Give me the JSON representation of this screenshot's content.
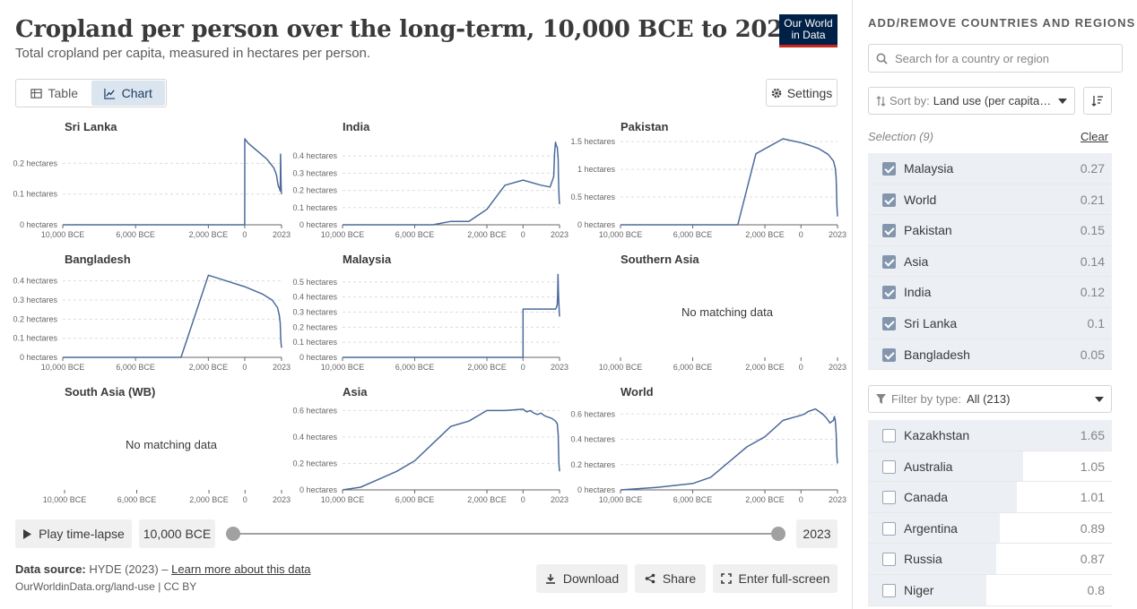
{
  "header": {
    "title": "Cropland per person over the long-term, 10,000 BCE to 2023",
    "subtitle": "Total cropland per capita, measured in hectares per person.",
    "logo_line1": "Our World",
    "logo_line2": "in Data"
  },
  "tabs": [
    {
      "label": "Table",
      "icon": "table-icon",
      "active": false
    },
    {
      "label": "Chart",
      "icon": "line-chart-icon",
      "active": true
    }
  ],
  "settings_label": "Settings",
  "timeline": {
    "play_label": "Play time-lapse",
    "start_label": "10,000 BCE",
    "end_label": "2023"
  },
  "footer": {
    "source_prefix": "Data source:",
    "source_text": "HYDE (2023) –",
    "learn_more": "Learn more about this data",
    "license": "OurWorldinData.org/land-use | CC BY",
    "download_label": "Download",
    "share_label": "Share",
    "fullscreen_label": "Enter full-screen"
  },
  "sidebar": {
    "heading": "ADD/REMOVE COUNTRIES AND REGIONS",
    "search_placeholder": "Search for a country or region",
    "sort_prefix": "Sort by:",
    "sort_value": "Land use (per capita):...",
    "selection_label": "Selection (9)",
    "clear_label": "Clear",
    "filter_prefix": "Filter by type:",
    "filter_value": "All (213)",
    "selected": [
      {
        "name": "Malaysia",
        "value": "0.27"
      },
      {
        "name": "World",
        "value": "0.21"
      },
      {
        "name": "Pakistan",
        "value": "0.15"
      },
      {
        "name": "Asia",
        "value": "0.14"
      },
      {
        "name": "India",
        "value": "0.12"
      },
      {
        "name": "Sri Lanka",
        "value": "0.1"
      },
      {
        "name": "Bangladesh",
        "value": "0.05"
      }
    ],
    "others": [
      {
        "name": "Kazakhstan",
        "value": "1.65",
        "share": 1.0
      },
      {
        "name": "Australia",
        "value": "1.05",
        "share": 0.636
      },
      {
        "name": "Canada",
        "value": "1.01",
        "share": 0.612
      },
      {
        "name": "Argentina",
        "value": "0.89",
        "share": 0.539
      },
      {
        "name": "Russia",
        "value": "0.87",
        "share": 0.527
      },
      {
        "name": "Niger",
        "value": "0.8",
        "share": 0.485
      }
    ]
  },
  "colors": {
    "line": "#4c6a9c",
    "grid": "#dddddd",
    "axis": "#666666",
    "bar": "#eceff4"
  },
  "chart_data": [
    {
      "type": "line",
      "title": "Sri Lanka",
      "yticks": [
        0,
        0.1,
        0.2
      ],
      "ylim": [
        0,
        0.28
      ],
      "unit": "hectares",
      "xticks": [
        "10,000 BCE",
        "6,000 BCE",
        "2,000 BCE",
        "0",
        "2023"
      ],
      "x": [
        -10000,
        0,
        1,
        200,
        600,
        800,
        1000,
        1200,
        1400,
        1600,
        1700,
        1750,
        1800,
        1850,
        1900,
        1950,
        1960,
        1970,
        1980,
        1990,
        2000,
        2010,
        2023
      ],
      "values": [
        0,
        0,
        0.28,
        0.265,
        0.245,
        0.235,
        0.225,
        0.215,
        0.2,
        0.185,
        0.17,
        0.16,
        0.14,
        0.125,
        0.12,
        0.11,
        0.15,
        0.23,
        0.2,
        0.16,
        0.13,
        0.11,
        0.1
      ]
    },
    {
      "type": "line",
      "title": "India",
      "yticks": [
        0,
        0.1,
        0.2,
        0.3,
        0.4
      ],
      "ylim": [
        0,
        0.5
      ],
      "unit": "hectares",
      "xticks": [
        "10,000 BCE",
        "6,000 BCE",
        "2,000 BCE",
        "0",
        "2023"
      ],
      "x": [
        -10000,
        -6000,
        -5000,
        -4000,
        -3000,
        -2000,
        -1000,
        0,
        1000,
        1500,
        1700,
        1750,
        1800,
        1850,
        1900,
        1950,
        1960,
        1970,
        1980,
        1990,
        2000,
        2010,
        2023
      ],
      "values": [
        0,
        0,
        0,
        0.02,
        0.02,
        0.09,
        0.23,
        0.26,
        0.23,
        0.22,
        0.28,
        0.42,
        0.48,
        0.46,
        0.45,
        0.38,
        0.3,
        0.26,
        0.22,
        0.19,
        0.16,
        0.14,
        0.12
      ]
    },
    {
      "type": "line",
      "title": "Pakistan",
      "yticks": [
        0,
        0.5,
        1,
        1.5
      ],
      "ylim": [
        0,
        1.55
      ],
      "unit": "hectares",
      "xticks": [
        "10,000 BCE",
        "6,000 BCE",
        "2,000 BCE",
        "0",
        "2023"
      ],
      "x": [
        -10000,
        -3500,
        -2500,
        -1000,
        0,
        500,
        1000,
        1500,
        1800,
        1900,
        1950,
        1970,
        1990,
        2023
      ],
      "values": [
        0,
        0,
        1.28,
        1.55,
        1.48,
        1.43,
        1.37,
        1.27,
        1.15,
        1.02,
        0.85,
        0.6,
        0.35,
        0.15
      ]
    },
    {
      "type": "line",
      "title": "Bangladesh",
      "yticks": [
        0,
        0.1,
        0.2,
        0.3,
        0.4
      ],
      "ylim": [
        0,
        0.45
      ],
      "unit": "hectares",
      "xticks": [
        "10,000 BCE",
        "6,000 BCE",
        "2,000 BCE",
        "0",
        "2023"
      ],
      "x": [
        -10000,
        -3500,
        -2000,
        -1000,
        0,
        1000,
        1500,
        1800,
        1900,
        1950,
        1970,
        1990,
        2023
      ],
      "values": [
        0,
        0,
        0.43,
        0.4,
        0.37,
        0.33,
        0.3,
        0.26,
        0.22,
        0.18,
        0.12,
        0.08,
        0.05
      ]
    },
    {
      "type": "line",
      "title": "Malaysia",
      "yticks": [
        0,
        0.1,
        0.2,
        0.3,
        0.4,
        0.5
      ],
      "ylim": [
        0,
        0.57
      ],
      "unit": "hectares",
      "xticks": [
        "10,000 BCE",
        "6,000 BCE",
        "2,000 BCE",
        "0",
        "2023"
      ],
      "x": [
        -10000,
        0,
        1,
        1500,
        1800,
        1850,
        1900,
        1920,
        1940,
        1960,
        1980,
        2000,
        2010,
        2023
      ],
      "values": [
        0,
        0,
        0.32,
        0.32,
        0.32,
        0.33,
        0.35,
        0.42,
        0.55,
        0.45,
        0.38,
        0.33,
        0.3,
        0.27
      ]
    },
    {
      "type": "line",
      "title": "Southern Asia",
      "message": "No matching data",
      "xticks": [
        "10,000 BCE",
        "6,000 BCE",
        "2,000 BCE",
        "0",
        "2023"
      ]
    },
    {
      "type": "line",
      "title": "South Asia (WB)",
      "message": "No matching data",
      "xticks": [
        "10,000 BCE",
        "6,000 BCE",
        "2,000 BCE",
        "0",
        "2023"
      ]
    },
    {
      "type": "line",
      "title": "Asia",
      "yticks": [
        0,
        0.2,
        0.4,
        0.6
      ],
      "ylim": [
        0,
        0.65
      ],
      "unit": "hectares",
      "xticks": [
        "10,000 BCE",
        "6,000 BCE",
        "2,000 BCE",
        "0",
        "2023"
      ],
      "x": [
        -10000,
        -9000,
        -8000,
        -7000,
        -6000,
        -5000,
        -4000,
        -3000,
        -2000,
        -1000,
        0,
        200,
        400,
        600,
        800,
        1000,
        1200,
        1400,
        1600,
        1800,
        1900,
        1950,
        1970,
        1990,
        2023
      ],
      "values": [
        0,
        0.02,
        0.08,
        0.14,
        0.22,
        0.35,
        0.48,
        0.52,
        0.6,
        0.6,
        0.61,
        0.59,
        0.6,
        0.58,
        0.57,
        0.58,
        0.56,
        0.55,
        0.54,
        0.52,
        0.5,
        0.42,
        0.3,
        0.2,
        0.14
      ]
    },
    {
      "type": "line",
      "title": "World",
      "yticks": [
        0,
        0.2,
        0.4,
        0.6
      ],
      "ylim": [
        0,
        0.68
      ],
      "unit": "hectares",
      "xticks": [
        "10,000 BCE",
        "6,000 BCE",
        "2,000 BCE",
        "0",
        "2023"
      ],
      "x": [
        -10000,
        -8000,
        -6000,
        -5000,
        -4000,
        -3000,
        -2000,
        -1000,
        0,
        200,
        400,
        600,
        800,
        1000,
        1200,
        1400,
        1600,
        1800,
        1850,
        1900,
        1950,
        1970,
        1990,
        2023
      ],
      "values": [
        0,
        0.02,
        0.05,
        0.1,
        0.22,
        0.34,
        0.42,
        0.55,
        0.59,
        0.6,
        0.62,
        0.63,
        0.64,
        0.62,
        0.6,
        0.57,
        0.53,
        0.55,
        0.58,
        0.55,
        0.45,
        0.35,
        0.27,
        0.21
      ]
    }
  ]
}
